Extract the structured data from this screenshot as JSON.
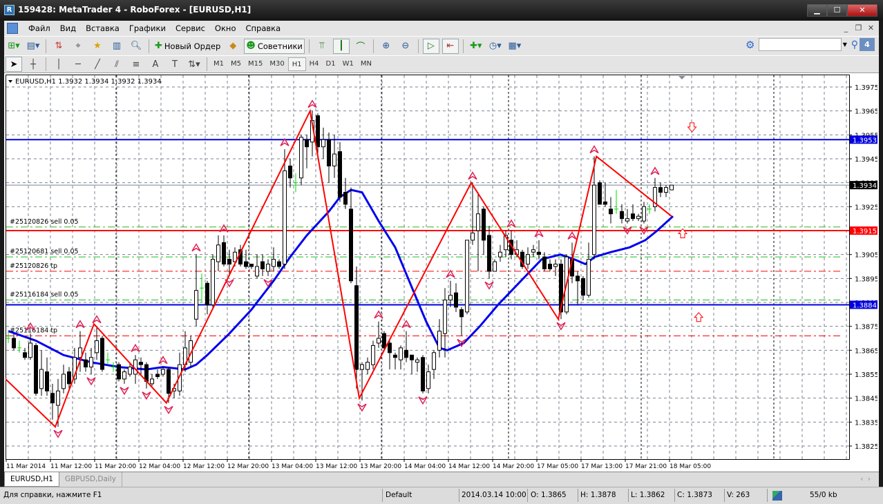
{
  "window": {
    "title": "159428: MetaTrader 4 - RoboForex - [EURUSD,H1]",
    "logo_letter": "R",
    "minimize": "▁",
    "maximize": "☐",
    "close": "✕"
  },
  "menu": [
    "Файл",
    "Вид",
    "Вставка",
    "Графики",
    "Сервис",
    "Окно",
    "Справка"
  ],
  "mdi_buttons": {
    "minimize": "_",
    "restore": "❐",
    "close": "✕"
  },
  "toolbar": {
    "new_order": "Новый Ордер",
    "experts": "Советники",
    "search_placeholder": "",
    "notification_count": "4"
  },
  "timeframes": [
    "M1",
    "M5",
    "M15",
    "M30",
    "H1",
    "H4",
    "D1",
    "W1",
    "MN"
  ],
  "active_timeframe": "H1",
  "tabs": [
    {
      "label": "EURUSD,H1",
      "active": true
    },
    {
      "label": "GBPUSD,Daily",
      "active": false
    }
  ],
  "statusbar": {
    "help": "Для справки, нажмите F1",
    "profile": "Default",
    "datetime": "2014.03.14 10:00",
    "open": "O: 1.3865",
    "high": "H: 1.3878",
    "low": "L: 1.3862",
    "close": "C: 1.3873",
    "volume": "V: 263",
    "traffic": "55/0 kb"
  },
  "colors": {
    "bull": "#ffffff",
    "bear": "#000000",
    "doji": "#00dd00",
    "ma": "#0000ee",
    "zigzag": "#ff0000",
    "fractal": "#dd2255",
    "grid": "#7a8290"
  },
  "chart_data": {
    "type": "candlestick",
    "symbol_header": "EURUSD,H1  1.3932 1.3934 1.3932 1.3934",
    "ylim": [
      1.3822,
      1.3982
    ],
    "y_ticks": [
      "1.3975",
      "1.3965",
      "1.3955",
      "1.3945",
      "1.3935",
      "1.3925",
      "1.3915",
      "1.3905",
      "1.3895",
      "1.3885",
      "1.3875",
      "1.3865",
      "1.3855",
      "1.3845",
      "1.3835",
      "1.3825"
    ],
    "x_labels": [
      "11 Mar 2014",
      "11 Mar 12:00",
      "11 Mar 20:00",
      "12 Mar 04:00",
      "12 Mar 12:00",
      "12 Mar 20:00",
      "13 Mar 04:00",
      "13 Mar 12:00",
      "13 Mar 20:00",
      "14 Mar 04:00",
      "14 Mar 12:00",
      "14 Mar 20:00",
      "17 Mar 05:00",
      "17 Mar 13:00",
      "17 Mar 21:00",
      "18 Mar 05:00"
    ],
    "x_label_step_bars": 8,
    "day_separator_bars": [
      20,
      44,
      68,
      91,
      115,
      139
    ],
    "ohlc": [
      [
        1.387,
        1.3873,
        1.3868,
        1.387
      ],
      [
        1.387,
        1.3872,
        1.3865,
        1.3866
      ],
      [
        1.3866,
        1.3869,
        1.3864,
        1.3866
      ],
      [
        1.3864,
        1.3866,
        1.3861,
        1.3862
      ],
      [
        1.3862,
        1.3872,
        1.3861,
        1.3868
      ],
      [
        1.3867,
        1.3868,
        1.3846,
        1.3847
      ],
      [
        1.3849,
        1.3865,
        1.3846,
        1.3857
      ],
      [
        1.3856,
        1.3862,
        1.3846,
        1.3848
      ],
      [
        1.3847,
        1.3851,
        1.3836,
        1.3843
      ],
      [
        1.3842,
        1.3853,
        1.3833,
        1.3848
      ],
      [
        1.3849,
        1.3859,
        1.3847,
        1.3855
      ],
      [
        1.3856,
        1.3858,
        1.3849,
        1.3851
      ],
      [
        1.3853,
        1.3866,
        1.3851,
        1.3862
      ],
      [
        1.3862,
        1.3873,
        1.3856,
        1.3866
      ],
      [
        1.3861,
        1.3864,
        1.3856,
        1.3858
      ],
      [
        1.3858,
        1.3866,
        1.3855,
        1.3862
      ],
      [
        1.3864,
        1.3875,
        1.3861,
        1.3869
      ],
      [
        1.387,
        1.3871,
        1.3856,
        1.3857
      ],
      [
        1.3861,
        1.3864,
        1.3859,
        1.3861
      ],
      [
        1.3858,
        1.386,
        1.3856,
        1.3858
      ],
      [
        1.3859,
        1.386,
        1.3852,
        1.3853
      ],
      [
        1.3853,
        1.3857,
        1.3851,
        1.3856
      ],
      [
        1.3855,
        1.386,
        1.3854,
        1.3858
      ],
      [
        1.3855,
        1.3863,
        1.3851,
        1.3861
      ],
      [
        1.386,
        1.3862,
        1.3855,
        1.3859
      ],
      [
        1.3859,
        1.386,
        1.3849,
        1.3852
      ],
      [
        1.3851,
        1.3855,
        1.385,
        1.3853
      ],
      [
        1.3855,
        1.3857,
        1.3853,
        1.3854
      ],
      [
        1.3855,
        1.3858,
        1.3854,
        1.3857
      ],
      [
        1.3857,
        1.3858,
        1.3843,
        1.3847
      ],
      [
        1.3848,
        1.3851,
        1.3845,
        1.3849
      ],
      [
        1.3848,
        1.3864,
        1.3846,
        1.3859
      ],
      [
        1.3859,
        1.3873,
        1.3856,
        1.3866
      ],
      [
        1.386,
        1.3871,
        1.3858,
        1.3869
      ],
      [
        1.3878,
        1.3905,
        1.3875,
        1.389
      ],
      [
        1.3891,
        1.3897,
        1.3885,
        1.3891
      ],
      [
        1.3893,
        1.3894,
        1.388,
        1.3884
      ],
      [
        1.3884,
        1.3905,
        1.3882,
        1.3903
      ],
      [
        1.3902,
        1.3913,
        1.3898,
        1.3909
      ],
      [
        1.391,
        1.3913,
        1.39,
        1.3901
      ],
      [
        1.3903,
        1.3907,
        1.3896,
        1.3901
      ],
      [
        1.3902,
        1.3908,
        1.39,
        1.3906
      ],
      [
        1.3907,
        1.3909,
        1.39,
        1.3901
      ],
      [
        1.3902,
        1.3907,
        1.3899,
        1.39
      ],
      [
        1.3901,
        1.3901,
        1.3899,
        1.39
      ],
      [
        1.3896,
        1.3905,
        1.3895,
        1.39
      ],
      [
        1.3902,
        1.3905,
        1.3896,
        1.3899
      ],
      [
        1.3898,
        1.3903,
        1.3896,
        1.3901
      ],
      [
        1.39,
        1.3908,
        1.3898,
        1.3903
      ],
      [
        1.3902,
        1.3903,
        1.3899,
        1.39
      ],
      [
        1.3901,
        1.3949,
        1.3899,
        1.394
      ],
      [
        1.3942,
        1.3945,
        1.3933,
        1.3937
      ],
      [
        1.3935,
        1.3939,
        1.3931,
        1.3935
      ],
      [
        1.3937,
        1.3955,
        1.3934,
        1.3954
      ],
      [
        1.3953,
        1.3955,
        1.3941,
        1.395
      ],
      [
        1.3952,
        1.3965,
        1.3946,
        1.3961
      ],
      [
        1.3963,
        1.3964,
        1.3946,
        1.395
      ],
      [
        1.395,
        1.3958,
        1.3945,
        1.3953
      ],
      [
        1.3953,
        1.3956,
        1.3935,
        1.3942
      ],
      [
        1.3942,
        1.3955,
        1.3937,
        1.3947
      ],
      [
        1.3948,
        1.3952,
        1.3927,
        1.3929
      ],
      [
        1.3931,
        1.3937,
        1.3924,
        1.3926
      ],
      [
        1.3924,
        1.3933,
        1.3893,
        1.3894
      ],
      [
        1.3892,
        1.39,
        1.3849,
        1.3857
      ],
      [
        1.3857,
        1.386,
        1.3844,
        1.3859
      ],
      [
        1.3857,
        1.3862,
        1.3855,
        1.386
      ],
      [
        1.3859,
        1.3869,
        1.3857,
        1.3867
      ],
      [
        1.3868,
        1.3877,
        1.3866,
        1.387
      ],
      [
        1.3872,
        1.3873,
        1.3865,
        1.3866
      ],
      [
        1.3868,
        1.3869,
        1.3857,
        1.3864
      ],
      [
        1.3863,
        1.3864,
        1.3857,
        1.3862
      ],
      [
        1.3861,
        1.3867,
        1.3857,
        1.3866
      ],
      [
        1.3865,
        1.3873,
        1.386,
        1.3862
      ],
      [
        1.3863,
        1.3863,
        1.3855,
        1.3861
      ],
      [
        1.386,
        1.3862,
        1.3856,
        1.3861
      ],
      [
        1.3862,
        1.3863,
        1.3847,
        1.3848
      ],
      [
        1.3849,
        1.3859,
        1.3847,
        1.3856
      ],
      [
        1.3857,
        1.3865,
        1.3853,
        1.3864
      ],
      [
        1.3865,
        1.3878,
        1.3862,
        1.3873
      ],
      [
        1.3872,
        1.3891,
        1.3862,
        1.3886
      ],
      [
        1.3886,
        1.3894,
        1.3883,
        1.3888
      ],
      [
        1.3889,
        1.3893,
        1.3881,
        1.3883
      ],
      [
        1.3882,
        1.3883,
        1.3871,
        1.3879
      ],
      [
        1.3881,
        1.3911,
        1.388,
        1.3911
      ],
      [
        1.3911,
        1.3935,
        1.3909,
        1.3914
      ],
      [
        1.3915,
        1.3931,
        1.3898,
        1.3922
      ],
      [
        1.3924,
        1.3925,
        1.3905,
        1.3911
      ],
      [
        1.3913,
        1.3917,
        1.3895,
        1.3898
      ],
      [
        1.3898,
        1.3903,
        1.3898,
        1.3902
      ],
      [
        1.3904,
        1.3909,
        1.3902,
        1.3906
      ],
      [
        1.3907,
        1.3915,
        1.3904,
        1.3913
      ],
      [
        1.3911,
        1.3915,
        1.3903,
        1.3905
      ],
      [
        1.3905,
        1.3911,
        1.3904,
        1.3907
      ],
      [
        1.3906,
        1.3907,
        1.3899,
        1.39
      ],
      [
        1.3901,
        1.3908,
        1.3899,
        1.3905
      ],
      [
        1.3906,
        1.3909,
        1.3904,
        1.3907
      ],
      [
        1.3906,
        1.3911,
        1.3903,
        1.3905
      ],
      [
        1.3904,
        1.3906,
        1.3898,
        1.3899
      ],
      [
        1.3901,
        1.3903,
        1.3898,
        1.3899
      ],
      [
        1.39,
        1.3903,
        1.3896,
        1.3901
      ],
      [
        1.3901,
        1.3903,
        1.3878,
        1.3881
      ],
      [
        1.3881,
        1.3905,
        1.388,
        1.3904
      ],
      [
        1.3903,
        1.391,
        1.3893,
        1.3896
      ],
      [
        1.3896,
        1.3898,
        1.3884,
        1.3894
      ],
      [
        1.3895,
        1.3896,
        1.3886,
        1.3888
      ],
      [
        1.3888,
        1.391,
        1.3887,
        1.3903
      ],
      [
        1.3905,
        1.3946,
        1.3903,
        1.3934
      ],
      [
        1.3935,
        1.3936,
        1.3926,
        1.3926
      ],
      [
        1.3927,
        1.3935,
        1.3925,
        1.3926
      ],
      [
        1.3924,
        1.3929,
        1.3918,
        1.3922
      ],
      [
        1.3924,
        1.3932,
        1.3922,
        1.3924
      ],
      [
        1.3923,
        1.3926,
        1.3918,
        1.392
      ],
      [
        1.3919,
        1.3924,
        1.3918,
        1.392
      ],
      [
        1.3922,
        1.3926,
        1.3919,
        1.392
      ],
      [
        1.392,
        1.3922,
        1.3919,
        1.3921
      ],
      [
        1.3919,
        1.3927,
        1.3918,
        1.3925
      ],
      [
        1.3924,
        1.3926,
        1.3922,
        1.3924
      ],
      [
        1.3925,
        1.3937,
        1.3923,
        1.3933
      ],
      [
        1.3933,
        1.3935,
        1.3929,
        1.3931
      ],
      [
        1.3931,
        1.3934,
        1.3929,
        1.3933
      ],
      [
        1.3932,
        1.3934,
        1.3932,
        1.3934
      ]
    ],
    "ma": [
      [
        0,
        1.3873
      ],
      [
        5,
        1.3869
      ],
      [
        10,
        1.3863
      ],
      [
        15,
        1.386
      ],
      [
        20,
        1.3858
      ],
      [
        25,
        1.3857
      ],
      [
        28,
        1.3858
      ],
      [
        32,
        1.3857
      ],
      [
        34,
        1.3859
      ],
      [
        36,
        1.3863
      ],
      [
        40,
        1.3872
      ],
      [
        44,
        1.3882
      ],
      [
        48,
        1.3894
      ],
      [
        51,
        1.3904
      ],
      [
        54,
        1.3913
      ],
      [
        58,
        1.3923
      ],
      [
        60,
        1.3929
      ],
      [
        62,
        1.3932
      ],
      [
        64,
        1.3931
      ],
      [
        67,
        1.3919
      ],
      [
        70,
        1.3908
      ],
      [
        73.6,
        1.3888
      ],
      [
        75.6,
        1.3877
      ],
      [
        78,
        1.3866
      ],
      [
        79.4,
        1.3865
      ],
      [
        82.4,
        1.3868
      ],
      [
        85.3,
        1.3875
      ],
      [
        88.6,
        1.3884
      ],
      [
        92.75,
        1.3894
      ],
      [
        94,
        1.3897
      ],
      [
        96.5,
        1.3903
      ],
      [
        99.9,
        1.3905
      ],
      [
        102.4,
        1.3903
      ],
      [
        104.4,
        1.3901
      ],
      [
        106.1,
        1.3904
      ],
      [
        109,
        1.3906
      ],
      [
        112.4,
        1.3908
      ],
      [
        115.25,
        1.3911
      ],
      [
        117.4,
        1.3915
      ],
      [
        120.25,
        1.3921
      ]
    ],
    "zigzag": [
      [
        -0.5,
        1.3853
      ],
      [
        8.5,
        1.3833
      ],
      [
        15.5,
        1.3876
      ],
      [
        28.6,
        1.3843
      ],
      [
        54.6,
        1.3965
      ],
      [
        63.5,
        1.3845
      ],
      [
        83.75,
        1.3935
      ],
      [
        99.5,
        1.3878
      ],
      [
        106.4,
        1.3946
      ],
      [
        120,
        1.3921
      ]
    ],
    "fractals_up": [
      4,
      13,
      16,
      23,
      28,
      34,
      39,
      50,
      55,
      67,
      72,
      80,
      84,
      91,
      96,
      102,
      106,
      117
    ],
    "fractals_down": [
      9,
      15,
      21,
      25,
      29,
      40,
      47,
      64,
      75,
      82,
      87,
      100,
      112,
      115
    ],
    "signals": [
      {
        "bar": 123.7,
        "price": 1.3958,
        "dir": "down"
      },
      {
        "bar": 122,
        "price": 1.3914,
        "dir": "up"
      },
      {
        "bar": 124.9,
        "price": 1.3879,
        "dir": "up"
      }
    ],
    "levels": [
      {
        "price": 1.3953,
        "color": "#0000dd",
        "style": "solid",
        "tag": "1.3953",
        "tag_bg": "#0000dd"
      },
      {
        "price": 1.3934,
        "color": "#7a8290",
        "style": "thin",
        "tag": "1.3934",
        "tag_bg": "#000000"
      },
      {
        "price": 1.3915,
        "color": "#ff0000",
        "style": "solid",
        "tag": "1.3915",
        "tag_bg": "#ff0000"
      },
      {
        "price": 1.3884,
        "color": "#0000dd",
        "style": "solid",
        "tag": "1.3884",
        "tag_bg": "#0000dd"
      }
    ],
    "order_lines": [
      {
        "price": 1.39165,
        "color": "#22bb22",
        "label": "#25120826 sell 0.05"
      },
      {
        "price": 1.3904,
        "color": "#22bb22",
        "label": "#25120681 sell 0.05"
      },
      {
        "price": 1.3898,
        "color": "#ff0000",
        "label": "#25120826 tp"
      },
      {
        "price": 1.3886,
        "color": "#22bb22",
        "label": "#25116184 sell 0.05"
      },
      {
        "price": 1.3871,
        "color": "#ff0000",
        "label": "#25116184 tp"
      }
    ]
  }
}
